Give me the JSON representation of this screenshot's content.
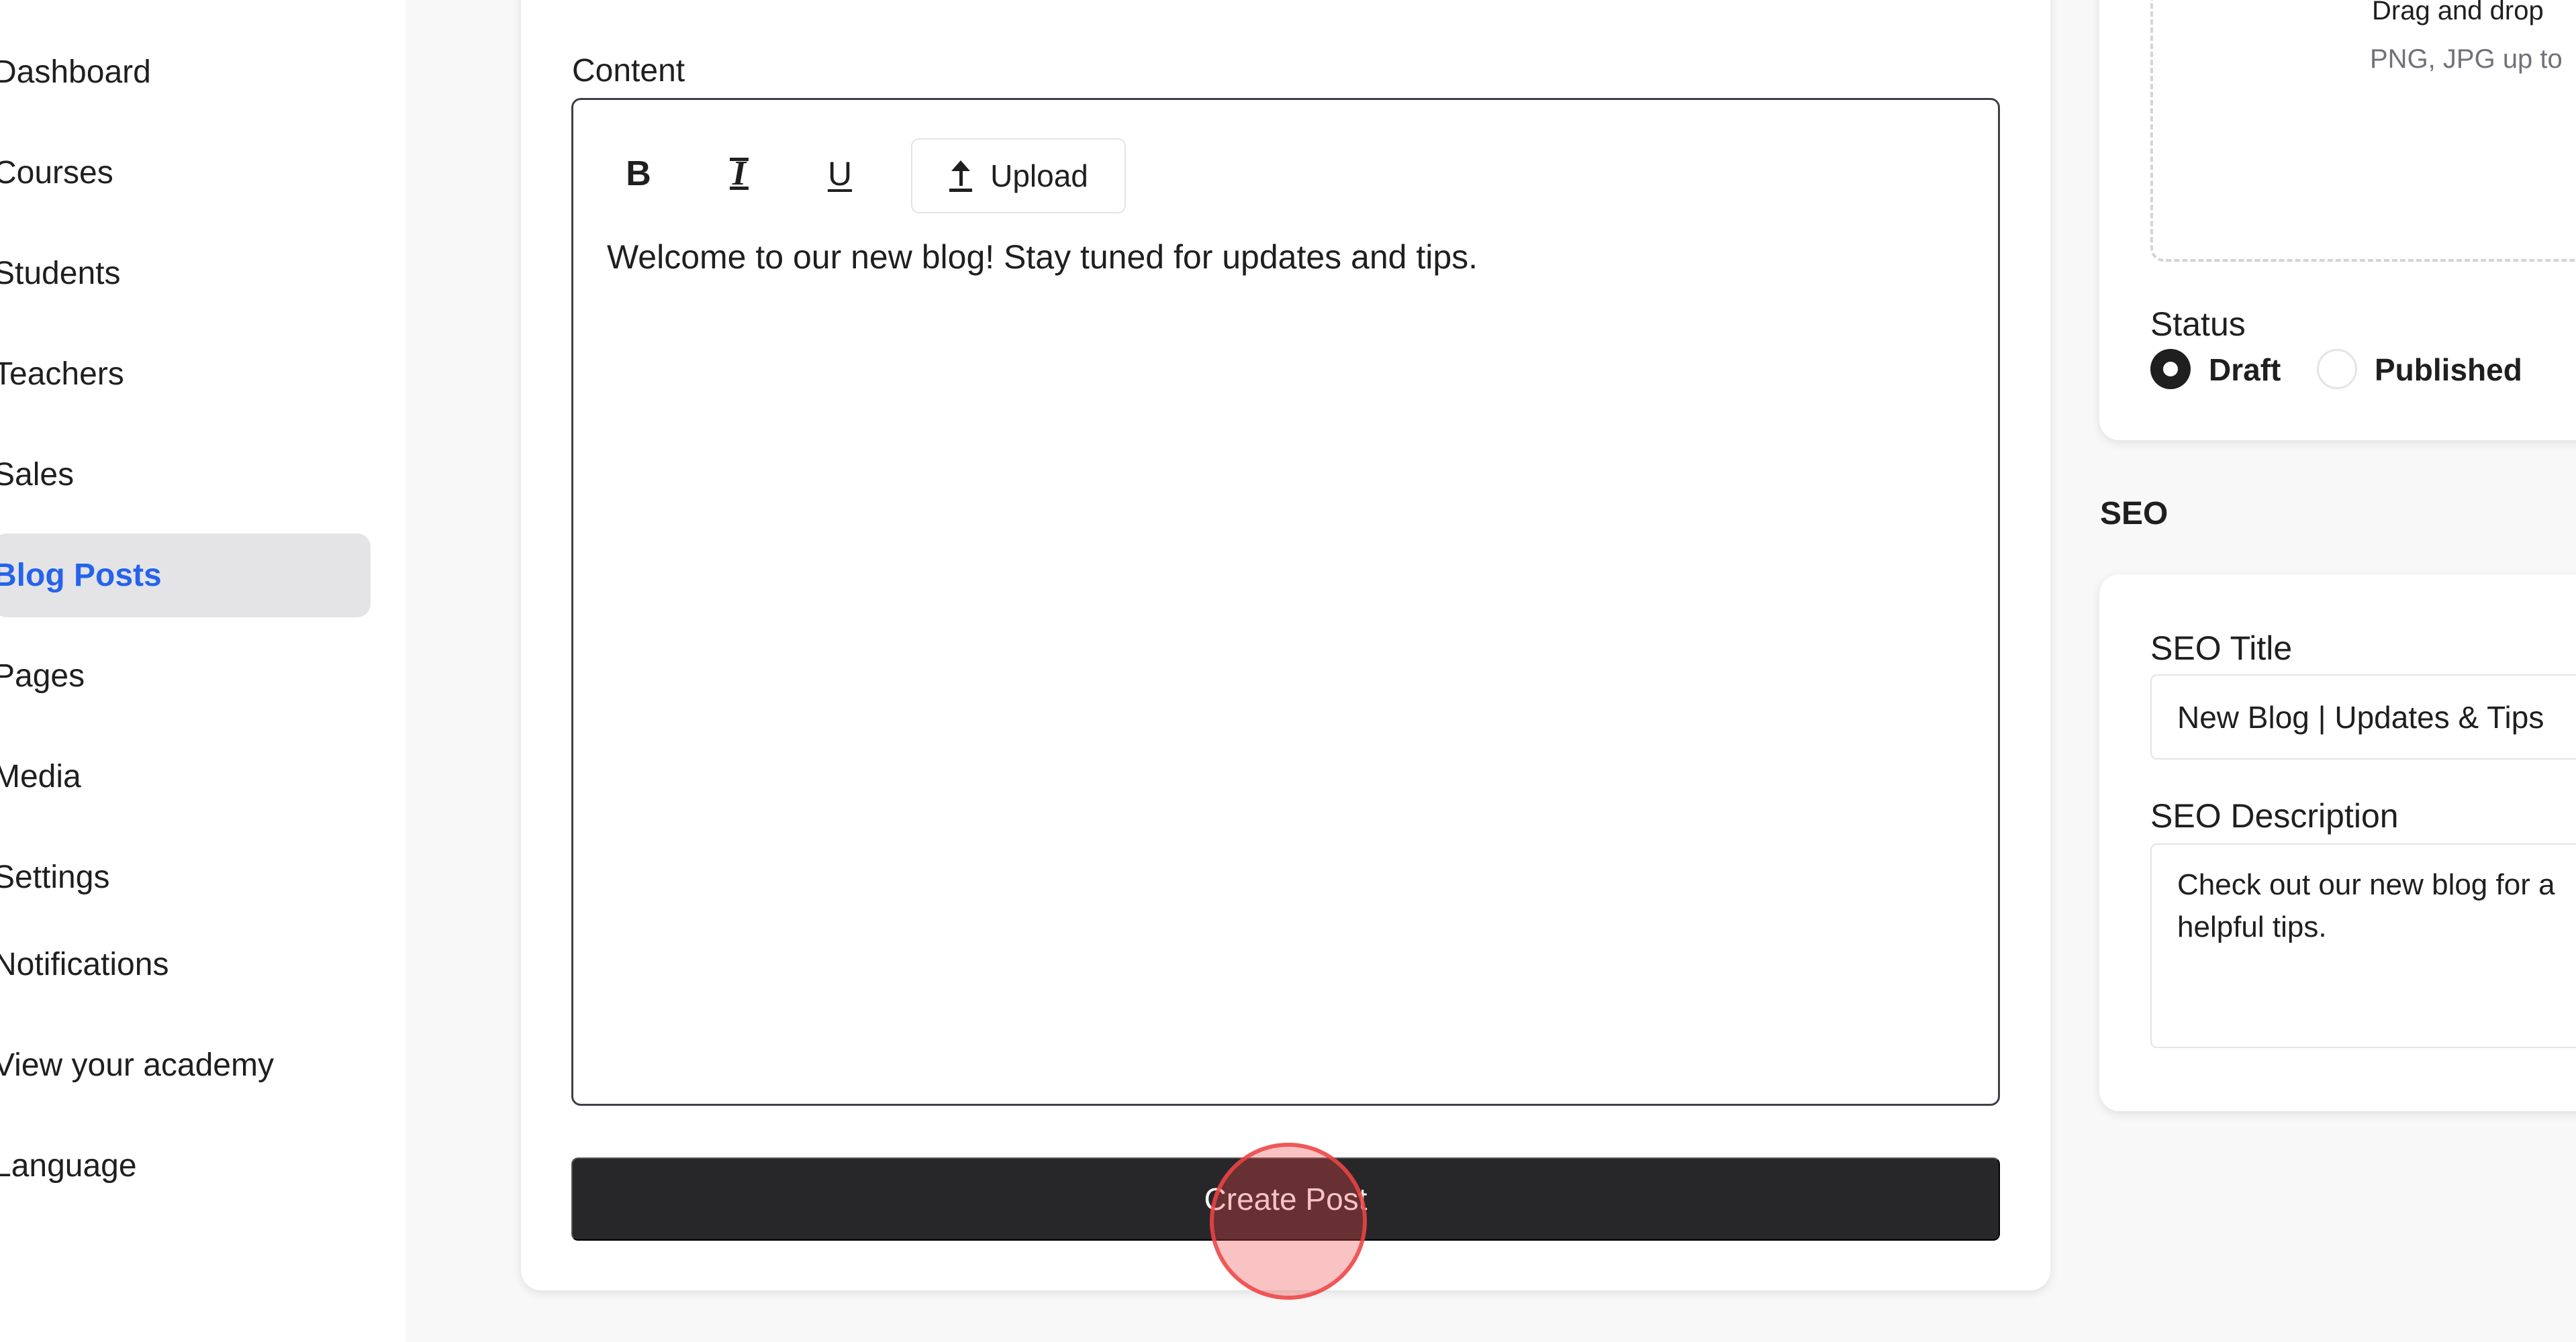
{
  "sidebar": {
    "items": [
      {
        "label": "Dashboard"
      },
      {
        "label": "Courses"
      },
      {
        "label": "Students"
      },
      {
        "label": "Teachers"
      },
      {
        "label": "Sales"
      },
      {
        "label": "Blog Posts",
        "active": true
      },
      {
        "label": "Pages"
      },
      {
        "label": "Media"
      },
      {
        "label": "Settings"
      },
      {
        "label": "Notifications"
      },
      {
        "label": "View your academy"
      },
      {
        "label": "Language"
      }
    ]
  },
  "editor": {
    "content_label": "Content",
    "toolbar": {
      "bold": "B",
      "italic": "I",
      "underline": "U",
      "upload_label": "Upload"
    },
    "text": "Welcome to our new blog! Stay tuned for updates and tips."
  },
  "actions": {
    "create_post_label": "Create Post"
  },
  "image_upload": {
    "drop_text": "Drag and drop",
    "hint": "PNG, JPG up to"
  },
  "status": {
    "label": "Status",
    "options": [
      {
        "label": "Draft",
        "selected": true
      },
      {
        "label": "Published",
        "selected": false
      }
    ]
  },
  "seo": {
    "heading": "SEO",
    "title_label": "SEO Title",
    "title_value": "New Blog | Updates & Tips",
    "description_label": "SEO Description",
    "description_value": "Check out our new blog for a\nhelpful tips."
  },
  "colors": {
    "accent": "#2563eb",
    "button_dark": "#27272a",
    "click_indicator": "#ef4444"
  }
}
